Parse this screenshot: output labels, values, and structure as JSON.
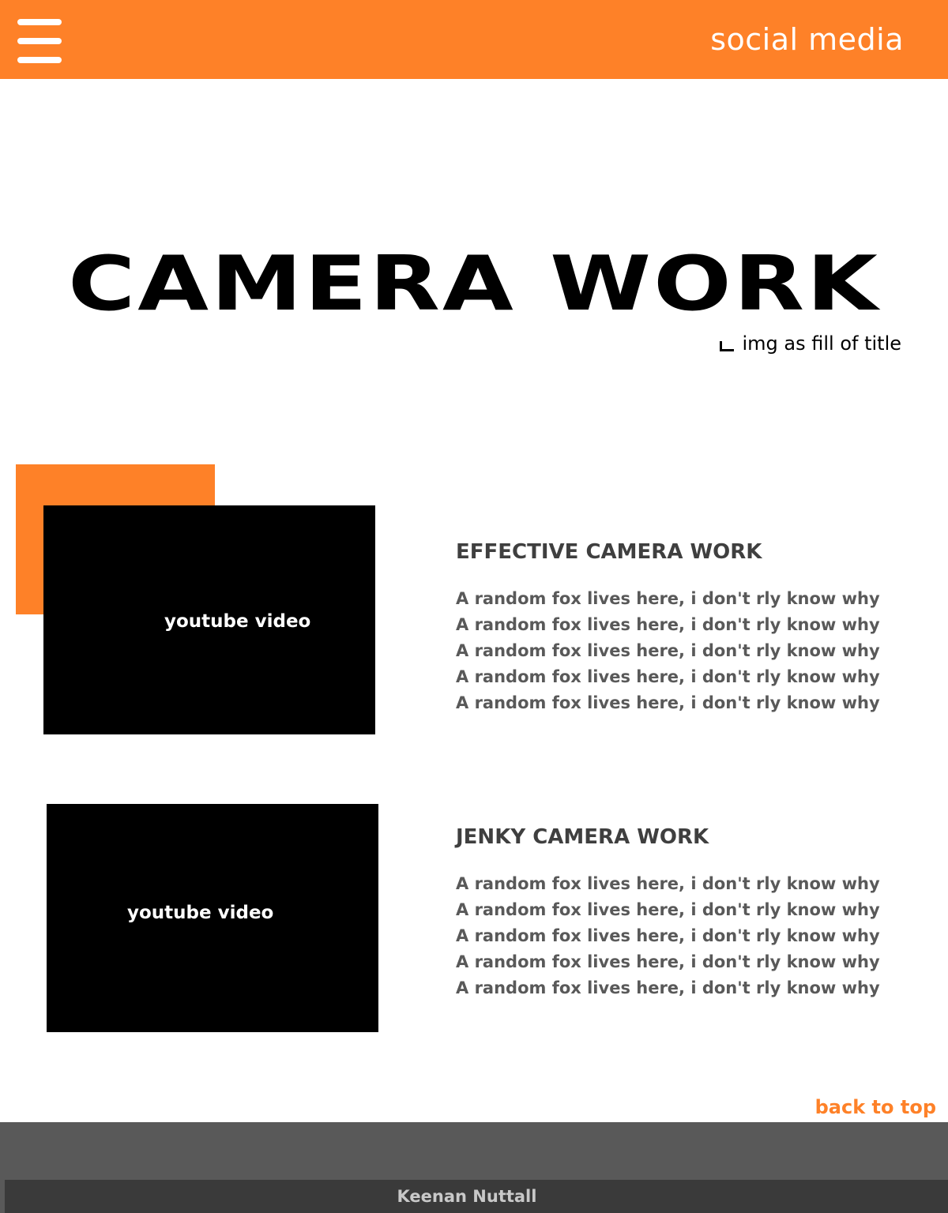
{
  "header": {
    "social_label": "social media"
  },
  "hero": {
    "title": "CAMERA WORK",
    "annotation": "img as fill of title"
  },
  "sections": [
    {
      "video_label": "youtube video",
      "heading": "EFFECTIVE CAMERA WORK",
      "lines": [
        "A random fox lives here, i don't rly know why",
        "A random fox lives here, i don't rly know why",
        "A random fox lives here, i don't rly know why",
        "A random fox lives here, i don't rly know why",
        "A random fox lives here, i don't rly know why"
      ]
    },
    {
      "video_label": "youtube video",
      "heading": "JENKY CAMERA WORK",
      "lines": [
        "A random fox lives here, i don't rly know why",
        "A random fox lives here, i don't rly know why",
        "A random fox lives here, i don't rly know why",
        "A random fox lives here, i don't rly know why",
        "A random fox lives here, i don't rly know why"
      ]
    }
  ],
  "back_to_top": "back to top",
  "footer": {
    "author": "Keenan Nuttall"
  },
  "colors": {
    "accent": "#fe8128",
    "heading_text": "#3f3f3f",
    "body_text": "#595959",
    "footer": "#595959",
    "footer_bar": "#3a3a3a"
  },
  "icons": {
    "menu": "hamburger-menu-icon",
    "annotation_marker": "corner-bracket-icon"
  }
}
